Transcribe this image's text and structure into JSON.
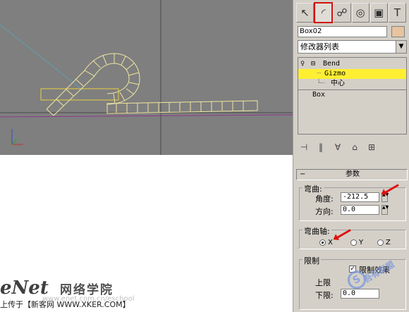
{
  "viewport": {
    "bg_color": "#7f7f7f",
    "object_color": "#f0e6a0"
  },
  "panel": {
    "tabs": [
      {
        "icon": "cursor-create-icon",
        "glyph": "↖"
      },
      {
        "icon": "modify-arc-icon",
        "glyph": "◜"
      },
      {
        "icon": "hierarchy-icon",
        "glyph": "☍"
      },
      {
        "icon": "motion-icon",
        "glyph": "◎"
      },
      {
        "icon": "display-icon",
        "glyph": "▣"
      },
      {
        "icon": "utilities-hammer-icon",
        "glyph": "T"
      }
    ],
    "object_name": "Box02",
    "object_color": "#e6c4a0",
    "modifier_list_label": "修改器列表",
    "stack": {
      "bend_label": "Bend",
      "gizmo_label": "Gizmo",
      "center_label": "中心",
      "box_label": "Box"
    },
    "stack_tool_icons": [
      "pin-stack-icon",
      "show-end-result-icon",
      "make-unique-icon",
      "remove-modifier-icon",
      "configure-sets-icon"
    ],
    "params": {
      "rollout_minus": "−",
      "rollout_title": "参数",
      "bend_group": "弯曲:",
      "angle_label": "角度:",
      "angle_value": "-212.5",
      "direction_label": "方向:",
      "direction_value": "0.0",
      "axis_group": "弯曲轴:",
      "axis_x": "X",
      "axis_y": "Y",
      "axis_z": "Z",
      "limit_group": "限制",
      "limit_effect_label": "限制效果",
      "upper_label": "上限",
      "lower_label": "下限:",
      "lower_value": "0.0"
    }
  },
  "watermark": {
    "brand": "eNet",
    "brand_cn": "网络学院",
    "upload_text": "上传于【新客网 WWW.XKER.COM】",
    "faint_url": "www.enet.com.cn/eschool",
    "stamp_letter": "S",
    "stamp_text": "吾有联盟"
  }
}
